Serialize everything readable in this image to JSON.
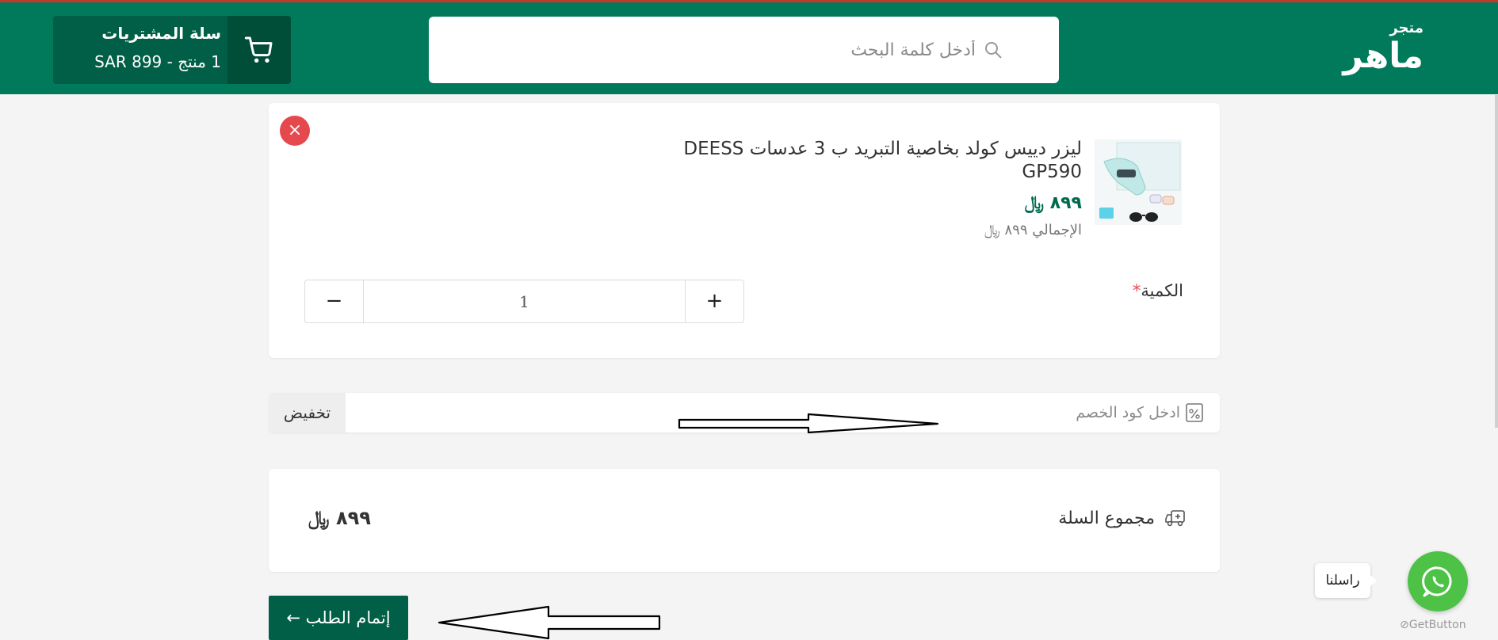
{
  "header": {
    "logo_small": "متجر",
    "logo_big": "ماهر",
    "search_placeholder": "أدخل كلمة البحث",
    "cart_title": "سلة المشتريات",
    "cart_summary": "1 منتج - SAR 899"
  },
  "item": {
    "name": "ليزر دييس كولد بخاصية التبريد ب 3 عدسات DEESS GP590",
    "price": "٨٩٩ ﷼",
    "total": "الإجمالي ٨٩٩ ﷼",
    "quantity_label": "الكمية",
    "quantity_required_mark": "*",
    "quantity_value": "1",
    "plus": "+",
    "minus": "−",
    "remove": "×"
  },
  "coupon": {
    "placeholder": "ادخل كود الخصم",
    "apply_label": "تخفيض"
  },
  "summary": {
    "label": "مجموع السلة",
    "value": "٨٩٩ ﷼"
  },
  "checkout": {
    "label": "إتمام الطلب ←"
  },
  "whatsapp": {
    "tooltip": "راسلنا",
    "credit": "GetButton"
  },
  "colors": {
    "brand": "#007a5a",
    "brand_dark": "#005f46",
    "danger": "#e5484d",
    "whatsapp": "#4dc247"
  }
}
